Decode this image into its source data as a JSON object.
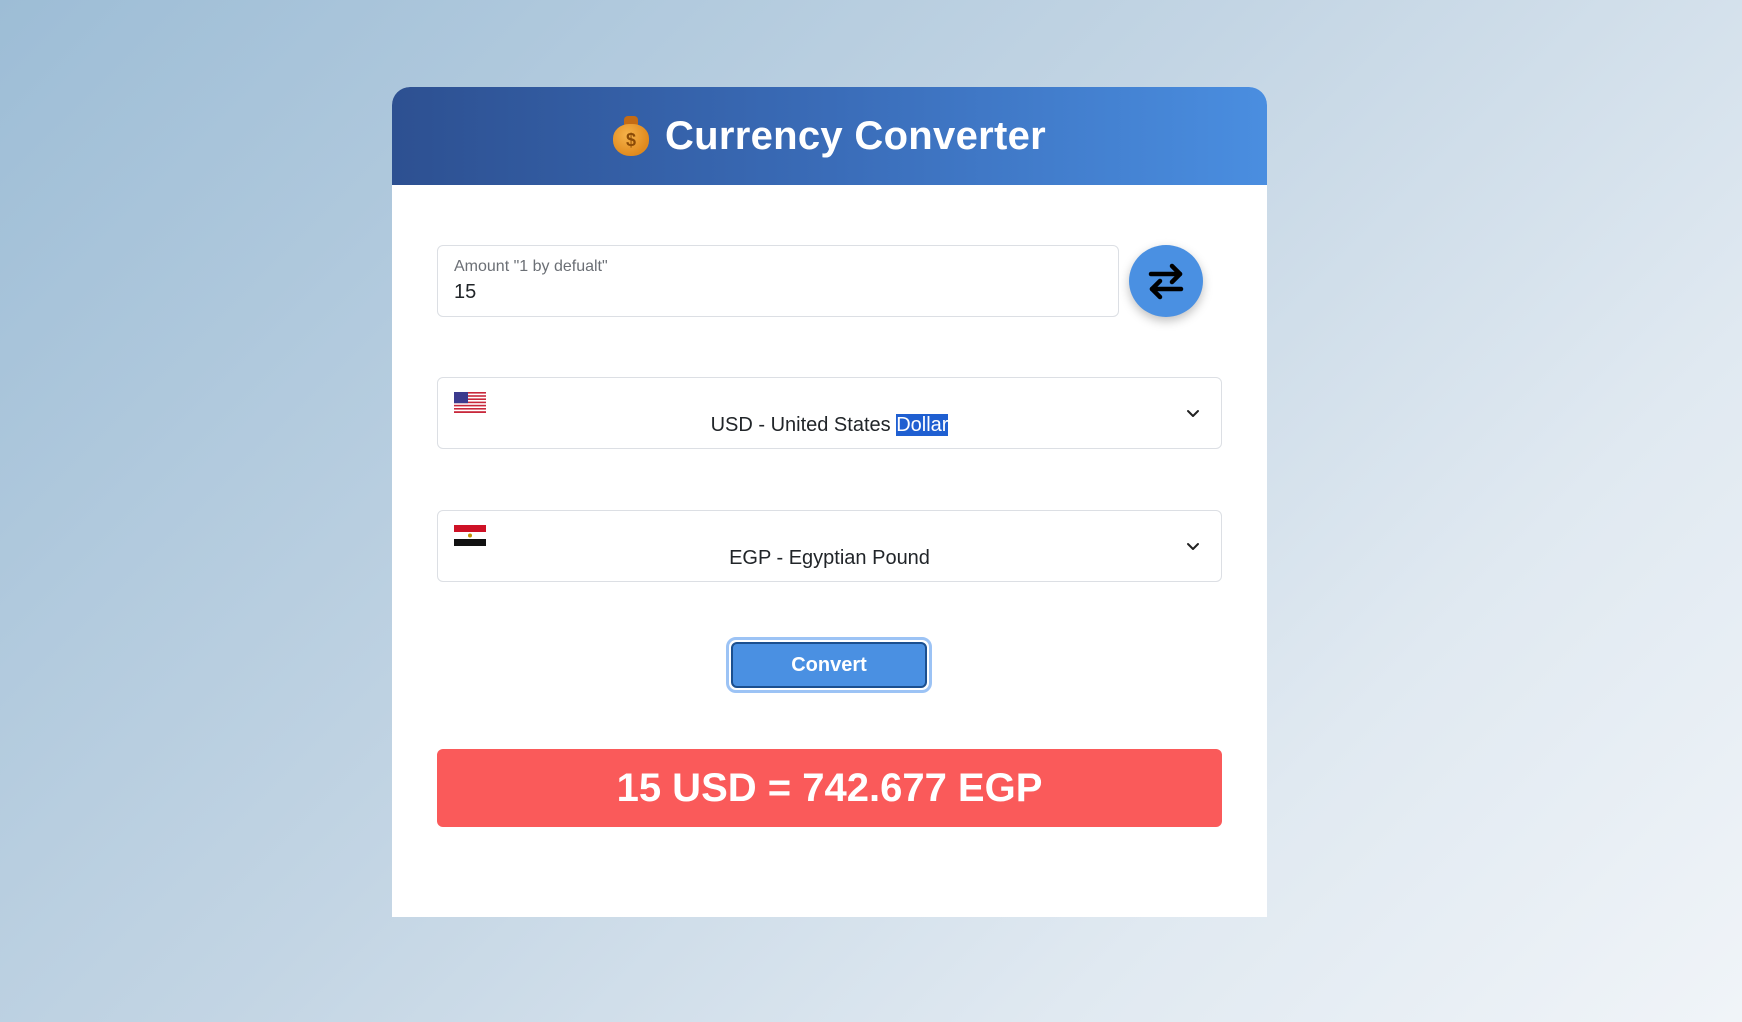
{
  "app": {
    "title": "Currency Converter",
    "icon": "money-bag-icon"
  },
  "amount": {
    "label": "Amount \"1 by defualt\"",
    "value": "15"
  },
  "swap": {
    "icon": "swap-arrows-icon"
  },
  "from_currency": {
    "label_before": "USD - United States ",
    "label_selected": "Dollar",
    "flag": "us-flag-icon"
  },
  "to_currency": {
    "label": "EGP - Egyptian Pound",
    "flag": "egypt-flag-icon"
  },
  "convert": {
    "label": "Convert"
  },
  "result": {
    "text": "15 USD = 742.677 EGP"
  },
  "colors": {
    "accent": "#4a90e2",
    "result_bg": "#fa5a5a",
    "header_start": "#2d5091",
    "header_end": "#4a8ee0"
  }
}
